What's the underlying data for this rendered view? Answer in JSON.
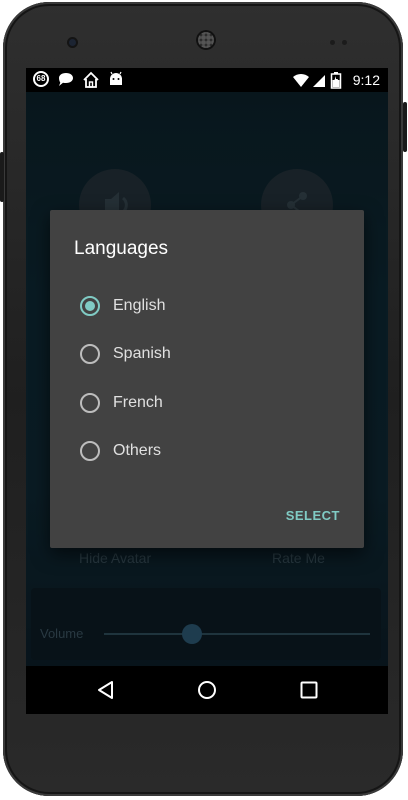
{
  "status_bar": {
    "notification_count": "68",
    "icons": [
      "count-badge-icon",
      "chat-bubble-icon",
      "home-icon",
      "android-icon"
    ],
    "right_icons": [
      "wifi-icon",
      "signal-icon",
      "battery-icon"
    ],
    "time": "9:12"
  },
  "background": {
    "buttons": [
      "speaker-icon",
      "share-icon"
    ],
    "labels": {
      "hide_avatar": "Hide Avatar",
      "rate_me": "Rate Me"
    },
    "volume": {
      "label": "Volume",
      "value_fraction": 0.33
    }
  },
  "dialog": {
    "title": "Languages",
    "options": [
      {
        "label": "English",
        "selected": true
      },
      {
        "label": "Spanish",
        "selected": false
      },
      {
        "label": "French",
        "selected": false
      },
      {
        "label": "Others",
        "selected": false
      }
    ],
    "action": "SELECT",
    "accent_color": "#80cbc4"
  },
  "nav_bar": {
    "buttons": [
      "back-icon",
      "home-circle-icon",
      "recents-icon"
    ]
  }
}
